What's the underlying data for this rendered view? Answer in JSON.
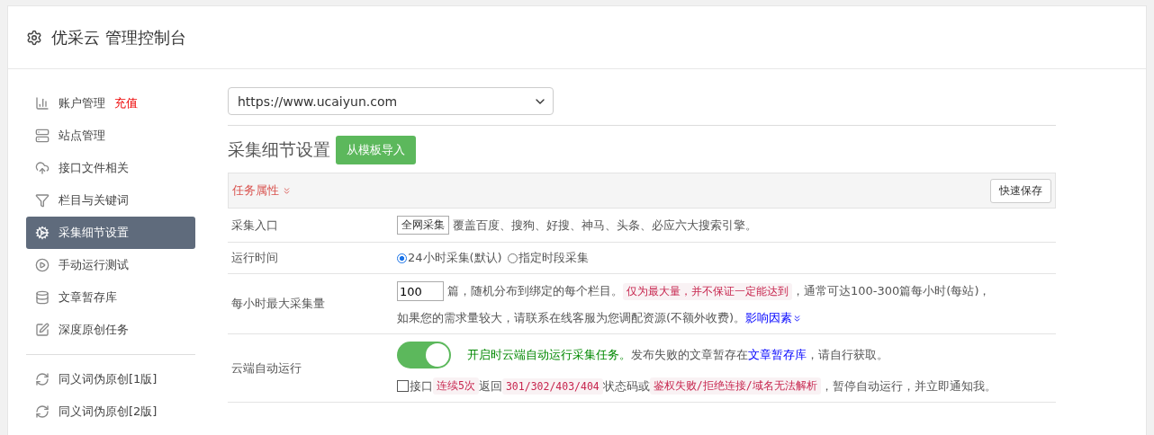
{
  "header": {
    "title": "优采云 管理控制台"
  },
  "sidebar": {
    "groups": [
      {
        "items": [
          {
            "label": "账户管理",
            "badge": "充值",
            "selected": false
          },
          {
            "label": "站点管理",
            "selected": false
          },
          {
            "label": "接口文件相关",
            "selected": false
          },
          {
            "label": "栏目与关键词",
            "selected": false
          },
          {
            "label": "采集细节设置",
            "selected": true
          },
          {
            "label": "手动运行测试",
            "selected": false
          },
          {
            "label": "文章暂存库",
            "selected": false
          },
          {
            "label": "深度原创任务",
            "selected": false
          }
        ]
      },
      {
        "items": [
          {
            "label": "同义词伪原创[1版]",
            "selected": false
          },
          {
            "label": "同义词伪原创[2版]",
            "selected": false
          }
        ]
      }
    ]
  },
  "site_select": {
    "value": "https://www.ucaiyun.com"
  },
  "section": {
    "title": "采集细节设置",
    "import_button": "从模板导入"
  },
  "panel": {
    "heading": "任务属性",
    "save_button": "快速保存"
  },
  "rows": [
    {
      "kind": "source",
      "label": "采集入口",
      "select": "全网采集",
      "text": "覆盖百度、搜狗、好搜、神马、头条、必应六大搜索引擎。"
    },
    {
      "kind": "radios",
      "label": "运行时间",
      "options": [
        {
          "label": "24小时采集(默认)",
          "selected": true
        },
        {
          "label": "指定时段采集",
          "selected": false
        }
      ]
    },
    {
      "kind": "rate",
      "label": "每小时最大采集量",
      "value": "100",
      "text1": "篇，随机分布到绑定的每个栏目。",
      "code": "仅为最大量，并不保证一定能达到",
      "text2": "，通常可达100-300篇每小时(每站)，",
      "text3": "如果您的需求量较大，请联系在线客服为您调配资源(不额外收费)。",
      "link": "影响因素"
    },
    {
      "kind": "cloud",
      "label": "云端自动运行",
      "on": true,
      "green": "开启时云端自动运行采集任务。",
      "text": "发布失败的文章暂存在",
      "link": "文章暂存库",
      "text_after": "，请自行获取。",
      "checked": false,
      "c1": "接口",
      "code1": "连续5次",
      "c2": "返回",
      "code2": "301/302/403/404",
      "c3": "状态码或",
      "code3": "鉴权失败/拒绝连接/域名无法解析",
      "c4": "，暂停自动运行，并立即通知我。"
    }
  ]
}
